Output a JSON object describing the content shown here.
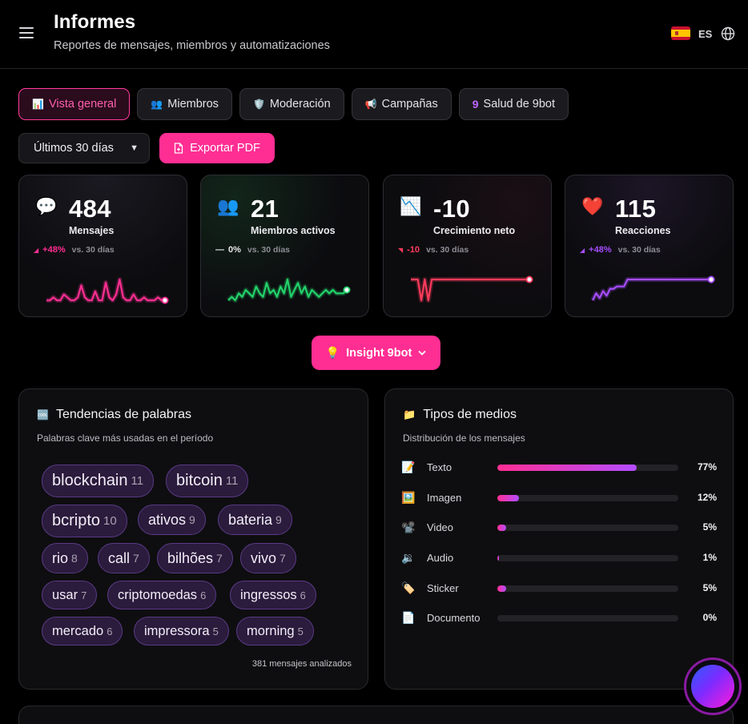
{
  "header": {
    "title": "Informes",
    "subtitle": "Reportes de mensajes, miembros y automatizaciones",
    "lang_code": "ES",
    "menu_icon": "menu-icon",
    "flag_icon": "spain-flag-icon",
    "globe_icon": "globe-icon"
  },
  "tabs": [
    {
      "label": "Vista general",
      "icon": "📊",
      "active": true
    },
    {
      "label": "Miembros",
      "icon": "👥",
      "active": false
    },
    {
      "label": "Moderación",
      "icon": "🛡️",
      "active": false
    },
    {
      "label": "Campañas",
      "icon": "📢",
      "active": false
    },
    {
      "label": "Salud de 9bot",
      "icon": "9",
      "active": false
    }
  ],
  "controls": {
    "range_value": "Últimos 30 días",
    "export_label": "Exportar PDF"
  },
  "kpis": [
    {
      "icon": "💬",
      "value": "484",
      "label": "Mensajes",
      "delta": "+48%",
      "delta_icon": "◢",
      "vs": "vs. 30 días",
      "color": "#ff2e93",
      "series": [
        1,
        1,
        2,
        1,
        1,
        3,
        2,
        1,
        1,
        2,
        6,
        2,
        1,
        1,
        4,
        1,
        1,
        7,
        2,
        1,
        3,
        8,
        2,
        1,
        1,
        3,
        1,
        1,
        2,
        1,
        1,
        1,
        2,
        1,
        1
      ]
    },
    {
      "icon": "👥",
      "value": "21",
      "label": "Miembros activos",
      "delta": "0%",
      "delta_icon": "—",
      "vs": "vs. 30 días",
      "color": "#22d36a",
      "series": [
        1,
        2,
        1,
        3,
        2,
        4,
        3,
        2,
        5,
        3,
        2,
        6,
        3,
        4,
        2,
        5,
        3,
        7,
        2,
        4,
        6,
        3,
        5,
        2,
        4,
        3,
        2,
        3,
        4,
        3,
        4,
        3,
        3,
        3,
        4
      ]
    },
    {
      "icon": "📉",
      "value": "-10",
      "label": "Crecimiento neto",
      "delta": "-10",
      "delta_icon": "◥",
      "vs": "vs. 30 días",
      "color": "#ff3b5c",
      "series": [
        0,
        0,
        0,
        -3,
        0,
        -3,
        0,
        0,
        0,
        0,
        0,
        0,
        0,
        0,
        0,
        0,
        0,
        0,
        0,
        0,
        0,
        0,
        0,
        0,
        0,
        0,
        0,
        0,
        0,
        0,
        0,
        0,
        0,
        0,
        0
      ]
    },
    {
      "icon": "❤️",
      "value": "115",
      "label": "Reacciones",
      "delta": "+48%",
      "delta_icon": "◢",
      "vs": "vs. 30 días",
      "color": "#a64dff",
      "series": [
        0,
        3,
        1,
        4,
        2,
        5,
        5,
        6,
        6,
        6,
        9,
        9,
        9,
        9,
        9,
        9,
        9,
        9,
        9,
        9,
        9,
        9,
        9,
        9,
        9,
        9,
        9,
        9,
        9,
        9,
        9,
        9,
        9,
        9,
        9
      ]
    }
  ],
  "insight": {
    "label": "Insight 9bot",
    "icon": "💡"
  },
  "words": {
    "title": "Tendencias de palabras",
    "icon": "🆒",
    "subtitle": "Palabras clave más usadas en el período",
    "items": [
      {
        "word": "blockchain",
        "count": "11"
      },
      {
        "word": "bitcoin",
        "count": "11"
      },
      {
        "word": "bcripto",
        "count": "10"
      },
      {
        "word": "ativos",
        "count": "9"
      },
      {
        "word": "bateria",
        "count": "9"
      },
      {
        "word": "rio",
        "count": "8"
      },
      {
        "word": "call",
        "count": "7"
      },
      {
        "word": "bilhões",
        "count": "7"
      },
      {
        "word": "vivo",
        "count": "7"
      },
      {
        "word": "usar",
        "count": "7"
      },
      {
        "word": "criptomoedas",
        "count": "6"
      },
      {
        "word": "ingressos",
        "count": "6"
      },
      {
        "word": "mercado",
        "count": "6"
      },
      {
        "word": "impressora",
        "count": "5"
      },
      {
        "word": "morning",
        "count": "5"
      }
    ],
    "footer": "381 mensajes analizados"
  },
  "media": {
    "title": "Tipos de medios",
    "icon": "📁",
    "subtitle": "Distribución de los mensajes",
    "items": [
      {
        "icon": "📝",
        "label": "Texto",
        "pct": "77%",
        "value": 77
      },
      {
        "icon": "🖼️",
        "label": "Imagen",
        "pct": "12%",
        "value": 12
      },
      {
        "icon": "📽️",
        "label": "Video",
        "pct": "5%",
        "value": 5
      },
      {
        "icon": "🔉",
        "label": "Audio",
        "pct": "1%",
        "value": 1
      },
      {
        "icon": "🏷️",
        "label": "Sticker",
        "pct": "5%",
        "value": 5
      },
      {
        "icon": "📄",
        "label": "Documento",
        "pct": "0%",
        "value": 0
      }
    ]
  }
}
